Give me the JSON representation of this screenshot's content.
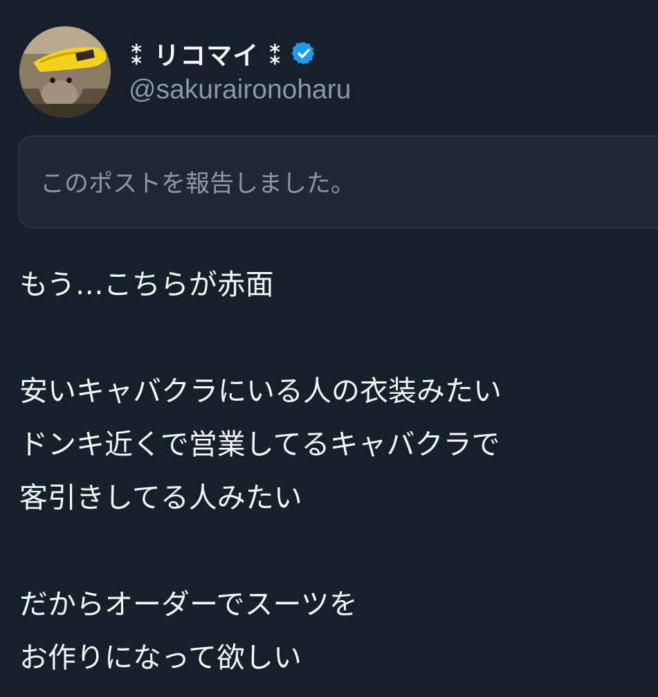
{
  "author": {
    "display_name": "⁑ リコマイ ⁑",
    "handle": "@sakuraironoharu",
    "verified": true,
    "avatar_icon": "avatar-rabbit-with-banana-hat",
    "verified_icon": "verified-badge-icon"
  },
  "report_notice": {
    "text": "このポストを報告しました。"
  },
  "post": {
    "lines": [
      "もう…こちらが赤面",
      "",
      "安いキャバクラにいる人の衣装みたい",
      "ドンキ近くで営業してるキャバクラで",
      "客引きしてる人みたい",
      "",
      "だからオーダーでスーツを",
      "お作りになって欲しい"
    ]
  },
  "colors": {
    "background": "#15202b",
    "primary_text": "#f7f9f9",
    "secondary_text": "#8b98a5",
    "verified_blue": "#1d9bf0",
    "border": "#38444d"
  }
}
